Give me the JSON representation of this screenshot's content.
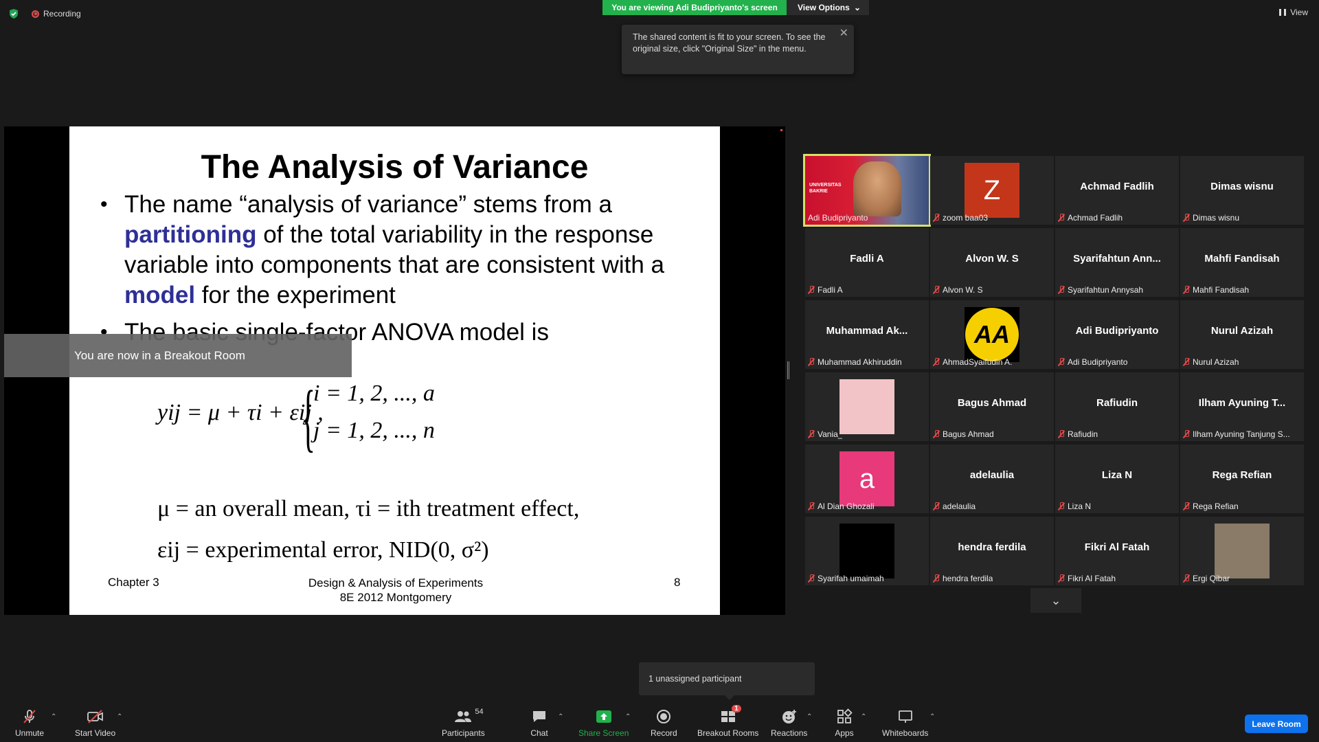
{
  "top": {
    "recording_label": "Recording",
    "viewing_banner": "You are viewing Adi Budipriyanto's screen",
    "view_options_label": "View Options",
    "view_label": "View",
    "tooltip_text": "The shared content is fit to your screen. To see the original size, click \"Original Size\" in the menu."
  },
  "slide": {
    "title": "The Analysis of Variance",
    "bullet1_a": "The name “analysis of variance” stems from a ",
    "bullet1_b": "partitioning",
    "bullet1_c": " of the total variability in the response variable into components that are consistent with a ",
    "bullet1_d": "model",
    "bullet1_e": " for the experiment",
    "bullet2": "The basic single-factor ANOVA model is",
    "eq_main": "yij = μ + τi + εij ,",
    "eq_i": "i = 1, 2, ..., a",
    "eq_j": "j = 1, 2, ..., n",
    "def1": "μ =  an overall mean,  τi = ith  treatment effect,",
    "def2": "εij =  experimental error,  NID(0, σ²)",
    "footer_chapter": "Chapter 3",
    "footer_center_line1": "Design & Analysis of Experiments",
    "footer_center_line2": "8E 2012 Montgomery",
    "footer_page": "8"
  },
  "breakout_banner": "You are now in a Breakout Room",
  "gallery": [
    {
      "name": "Adi Budipriyanto",
      "label": "Adi Budipriyanto",
      "type": "video",
      "muted": false
    },
    {
      "name": "Z",
      "label": "zoom baa03",
      "type": "avatar",
      "avatar_color": "#c4361a",
      "muted": true
    },
    {
      "name": "Achmad Fadlih",
      "label": "Achmad Fadlih",
      "type": "name",
      "muted": true
    },
    {
      "name": "Dimas wisnu",
      "label": "Dimas wisnu",
      "type": "name",
      "muted": true
    },
    {
      "name": "Fadli A",
      "label": "Fadli A",
      "type": "name",
      "muted": true
    },
    {
      "name": "Alvon W. S",
      "label": "Alvon W. S",
      "type": "name",
      "muted": true
    },
    {
      "name": "Syarifahtun  Ann...",
      "label": "Syarifahtun Annysah",
      "type": "name",
      "muted": true
    },
    {
      "name": "Mahfi Fandisah",
      "label": "Mahfi Fandisah",
      "type": "name",
      "muted": true
    },
    {
      "name": "Muhammad  Ak...",
      "label": "Muhammad Akhiruddin",
      "type": "name",
      "muted": true
    },
    {
      "name": "AA",
      "label": "AhmadSyaifudin A.",
      "type": "logo",
      "avatar_color": "#f5cf00",
      "muted": true
    },
    {
      "name": "Adi Budipriyanto",
      "label": "Adi Budipriyanto",
      "type": "name",
      "muted": true
    },
    {
      "name": "Nurul Azizah",
      "label": "Nurul Azizah",
      "type": "name",
      "muted": true
    },
    {
      "name": "",
      "label": "Vania_",
      "type": "avatar",
      "avatar_color": "#f2c4c8",
      "muted": true
    },
    {
      "name": "Bagus Ahmad",
      "label": "Bagus Ahmad",
      "type": "name",
      "muted": true
    },
    {
      "name": "Rafiudin",
      "label": "Rafiudin",
      "type": "name",
      "muted": true
    },
    {
      "name": "Ilham Ayuning T...",
      "label": "Ilham Ayuning Tanjung S...",
      "type": "name",
      "muted": true
    },
    {
      "name": "a",
      "label": "Al Dian Ghozali",
      "type": "avatar",
      "avatar_color": "#e8397a",
      "muted": true
    },
    {
      "name": "adelaulia",
      "label": "adelaulia",
      "type": "name",
      "muted": true
    },
    {
      "name": "Liza N",
      "label": "Liza N",
      "type": "name",
      "muted": true
    },
    {
      "name": "Rega Refian",
      "label": "Rega Refian",
      "type": "name",
      "muted": true
    },
    {
      "name": "",
      "label": "Syarifah umaimah",
      "type": "avatar",
      "avatar_color": "#000000",
      "muted": true
    },
    {
      "name": "hendra ferdila",
      "label": "hendra ferdila",
      "type": "name",
      "muted": true
    },
    {
      "name": "Fikri Al Fatah",
      "label": "Fikri Al Fatah",
      "type": "name",
      "muted": true
    },
    {
      "name": "",
      "label": "Ergi Qibar",
      "type": "avatar",
      "avatar_color": "#8a7a68",
      "muted": true
    }
  ],
  "video_tile_text": "UNIVERSITAS BAKRIE",
  "unassigned_popup": "1 unassigned participant",
  "toolbar": {
    "unmute": "Unmute",
    "start_video": "Start Video",
    "participants": "Participants",
    "participants_count": "54",
    "chat": "Chat",
    "share_screen": "Share Screen",
    "record": "Record",
    "breakout_rooms": "Breakout Rooms",
    "breakout_badge": "1",
    "reactions": "Reactions",
    "apps": "Apps",
    "whiteboards": "Whiteboards",
    "leave_room": "Leave Room"
  },
  "colors": {
    "share_green": "#22b14c",
    "leave_blue": "#0e72ed",
    "muted_red": "#e34b4b",
    "slide_blue": "#2f2f96",
    "active_outline": "#d8e06a"
  }
}
